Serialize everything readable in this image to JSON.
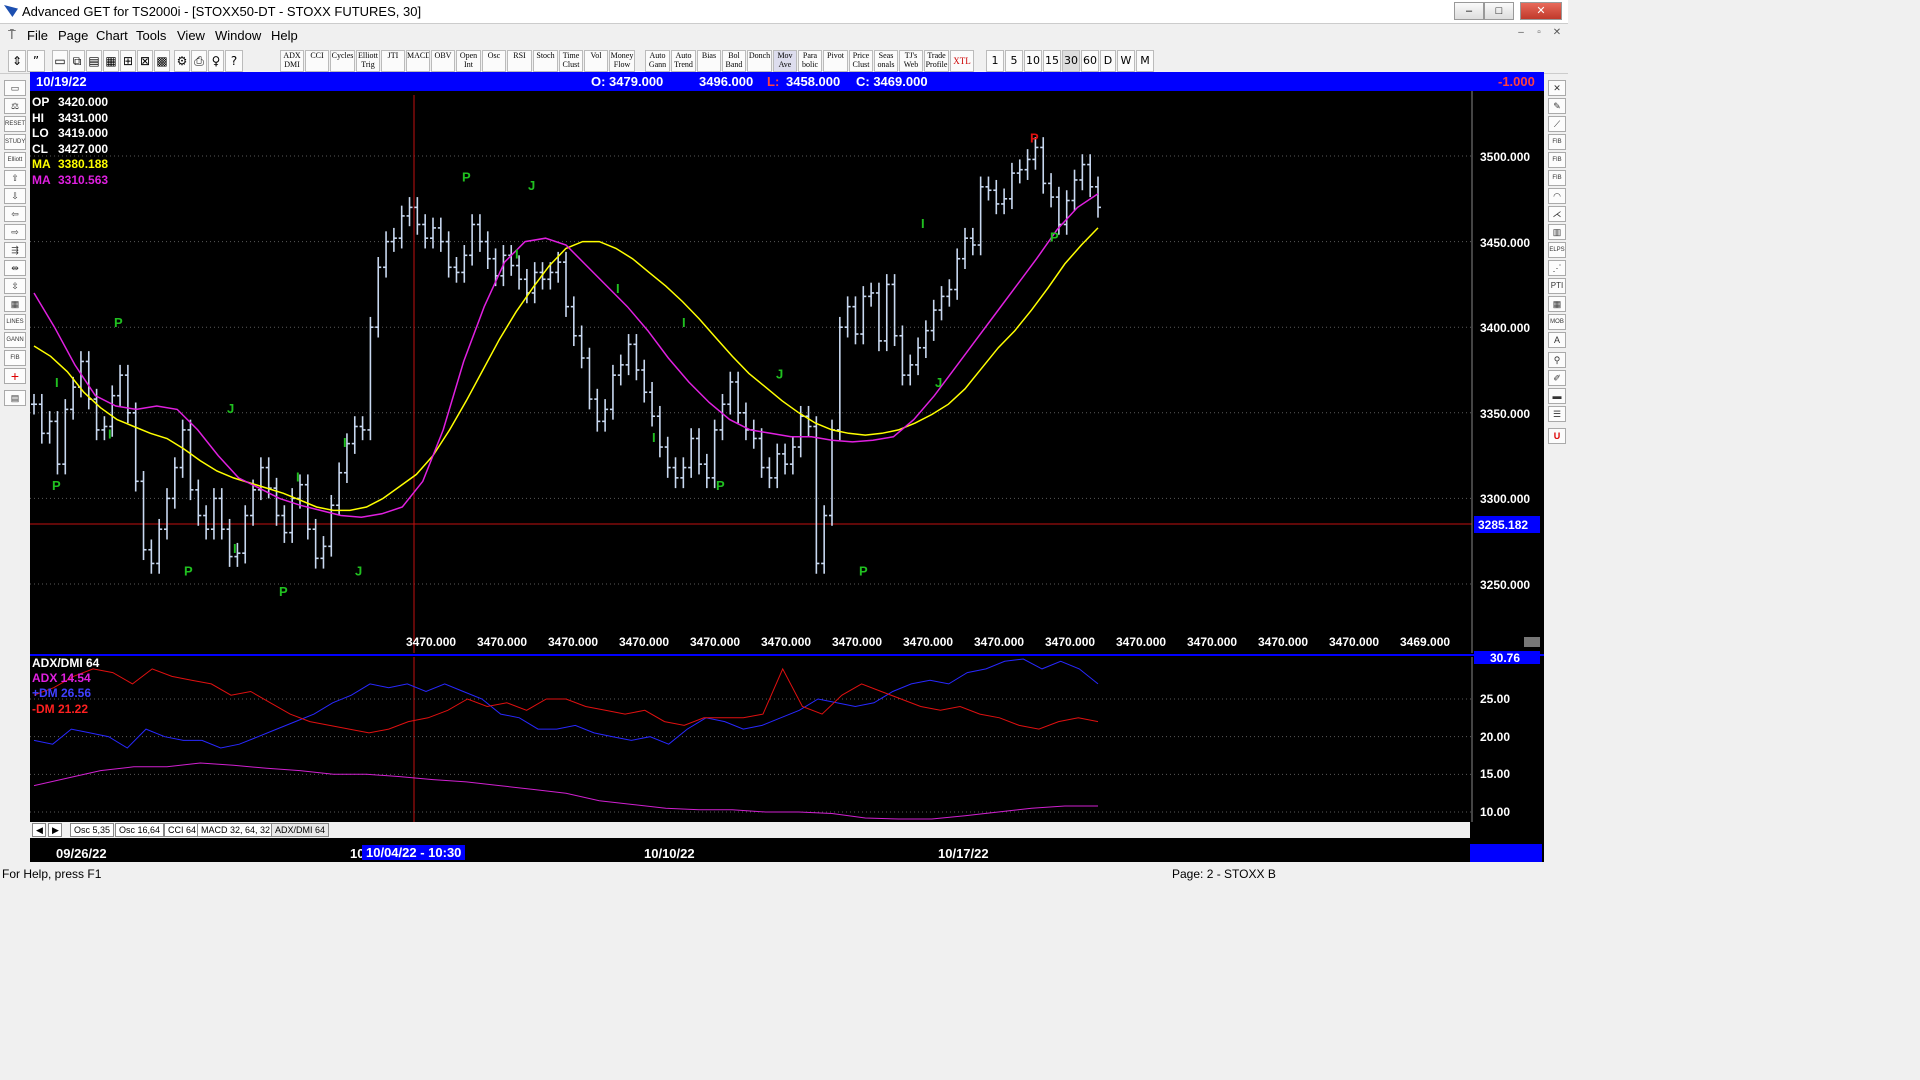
{
  "window": {
    "title": "Advanced GET for TS2000i - [STOXX50-DT - STOXX FUTURES, 30]",
    "min": "–",
    "max": "□",
    "close": "✕"
  },
  "menu": [
    "File",
    "Page",
    "Chart",
    "Tools",
    "View",
    "Window",
    "Help"
  ],
  "toolbar_studies": [
    "ADX DMI",
    "CCI",
    "Cycles",
    "Elliott Trig",
    "JTI",
    "MACD",
    "OBV",
    "Open Int",
    "Osc",
    "RSI",
    "Stoch",
    "Time Clust",
    "Vol",
    "Money Flow",
    "Auto Gann",
    "Auto Trend",
    "Bias",
    "Bol Band",
    "Donch",
    "Mov Ave",
    "Para bolic",
    "Pivot",
    "Price Clust",
    "Seas onals",
    "TJ's Web",
    "Trade Profile",
    "XTL"
  ],
  "toolbar_intervals": [
    "1",
    "5",
    "10",
    "15",
    "30",
    "60",
    "D",
    "W",
    "M"
  ],
  "header": {
    "date": "10/19/22",
    "open": "O: 3479.000",
    "high": "3496.000",
    "low_label": "L:",
    "low": "3458.000",
    "close": "C: 3469.000",
    "change": "-1.000"
  },
  "info": {
    "op_label": "OP",
    "op": "3420.000",
    "hi_label": "HI",
    "hi": "3431.000",
    "lo_label": "LO",
    "lo": "3419.000",
    "cl_label": "CL",
    "cl": "3427.000",
    "ma1_label": "MA",
    "ma1": "3380.188",
    "ma2_label": "MA",
    "ma2": "3310.563"
  },
  "price_axis": [
    "3500.000",
    "3450.000",
    "3400.000",
    "3350.000",
    "3300.000",
    "3250.000"
  ],
  "cursor_price": "3285.182",
  "bottom_values": [
    "3470.000",
    "3470.000",
    "3470.000",
    "3470.000",
    "3470.000",
    "3470.000",
    "3470.000",
    "3470.000",
    "3470.000",
    "3470.000",
    "3470.000",
    "3470.000",
    "3470.000",
    "3470.000",
    "3469.000"
  ],
  "wave_labels": [
    "I",
    "P",
    "I",
    "P",
    "P",
    "I",
    "J",
    "I",
    "P",
    "J",
    "I",
    "P",
    "I",
    "J",
    "I",
    "P",
    "J",
    "I",
    "P",
    "P",
    "I",
    "J",
    "P",
    "I"
  ],
  "indicator": {
    "name": "ADX/DMI 64",
    "adx": "ADX 14.54",
    "plus_dm": "+DM 26.56",
    "minus_dm": "-DM  21.22",
    "top_value": "30.76",
    "axis": [
      "25.00",
      "20.00",
      "15.00",
      "10.00"
    ]
  },
  "tabs": [
    "Osc 5,35",
    "Osc 16,64",
    "CCI 64",
    "MACD 32, 64, 32",
    "ADX/DMI 64"
  ],
  "dates": {
    "d1": "09/26/22",
    "d2_prefix": "10",
    "cursor_date": "10/04/22 - 10:30",
    "d3": "10/10/22",
    "d4": "10/17/22"
  },
  "status": {
    "help": "For Help, press F1",
    "page": "Page: 2 - STOXX B"
  },
  "chart_data": {
    "type": "line",
    "title": "",
    "ylim": [
      3220,
      3530
    ],
    "series": [
      {
        "values": [
          3355,
          3338,
          3345,
          3320,
          3352,
          3365,
          3380,
          3358,
          3340,
          3342,
          3360,
          3372,
          3350,
          3310,
          3270,
          3262,
          3282,
          3300,
          3318,
          3340,
          3305,
          3290,
          3282,
          3300,
          3282,
          3266,
          3268,
          3290,
          3305,
          3318,
          3306,
          3290,
          3280,
          3300,
          3308,
          3282,
          3265,
          3272,
          3296,
          3315,
          3332,
          3342,
          3340,
          3400,
          3435,
          3450,
          3452,
          3465,
          3470,
          3460,
          3452,
          3458,
          3450,
          3435,
          3432,
          3442,
          3460,
          3450,
          3440,
          3430,
          3442,
          3436,
          3428,
          3420,
          3432,
          3428,
          3432,
          3438,
          3412,
          3395,
          3382,
          3358,
          3345,
          3352,
          3372,
          3378,
          3390,
          3375,
          3362,
          3348,
          3330,
          3318,
          3312,
          3318,
          3335,
          3320,
          3312,
          3340,
          3355,
          3368,
          3350,
          3340,
          3335,
          3318,
          3312,
          3326,
          3320,
          3330,
          3348,
          3342,
          3262,
          3290,
          3340,
          3400,
          3412,
          3396,
          3418,
          3420,
          3392,
          3425,
          3395,
          3372,
          3378,
          3388,
          3398,
          3410,
          3418,
          3422,
          3440,
          3452,
          3448,
          3482,
          3480,
          3472,
          3475,
          3490,
          3492,
          3498,
          3505,
          3484,
          3476,
          3460,
          3474,
          3486,
          3495,
          3482,
          3470
        ]
      },
      {
        "name": "MA",
        "values": [
          3389,
          3383,
          3374,
          3362,
          3353,
          3346,
          3342,
          3338,
          3335,
          3329,
          3322,
          3316,
          3312,
          3309,
          3306,
          3303,
          3299,
          3295,
          3293,
          3293,
          3295,
          3300,
          3307,
          3314,
          3325,
          3340,
          3357,
          3375,
          3393,
          3409,
          3423,
          3436,
          3446,
          3450,
          3450,
          3446,
          3440,
          3432,
          3424,
          3415,
          3405,
          3394,
          3383,
          3373,
          3365,
          3357,
          3350,
          3344,
          3340,
          3338,
          3337,
          3338,
          3340,
          3344,
          3349,
          3355,
          3364,
          3376,
          3388,
          3398,
          3410,
          3423,
          3437,
          3448,
          3458
        ]
      },
      {
        "name": "MA",
        "values": [
          3420,
          3400,
          3378,
          3360,
          3354,
          3352,
          3354,
          3352,
          3340,
          3325,
          3312,
          3306,
          3300,
          3296,
          3293,
          3290,
          3289,
          3291,
          3295,
          3310,
          3340,
          3380,
          3412,
          3438,
          3450,
          3452,
          3448,
          3436,
          3424,
          3412,
          3398,
          3382,
          3368,
          3356,
          3346,
          3340,
          3338,
          3336,
          3336,
          3334,
          3333,
          3334,
          3336,
          3346,
          3360,
          3376,
          3392,
          3408,
          3424,
          3440,
          3457,
          3470,
          3478
        ]
      }
    ],
    "indicator_series": [
      {
        "name": "+DM",
        "values": [
          19.5,
          19,
          21,
          20.5,
          20,
          18.5,
          21,
          20,
          19.5,
          19.5,
          18.5,
          19,
          20,
          21,
          22,
          23,
          24.5,
          25.5,
          27,
          26.5,
          27,
          26,
          27,
          26,
          25,
          23,
          22.5,
          21,
          21,
          21.5,
          20.5,
          20,
          19.5,
          20,
          19,
          21,
          22.5,
          22,
          21,
          21.5,
          22.5,
          23.5,
          25,
          24.5,
          24,
          24.5,
          26,
          27,
          27.5,
          27,
          28.5,
          29,
          30,
          30.5,
          29,
          30,
          29,
          27
        ]
      },
      {
        "name": "-DM",
        "values": [
          25.5,
          26.5,
          28,
          29,
          28.5,
          27,
          29,
          28,
          27.5,
          27,
          25.5,
          26,
          24.5,
          23,
          22,
          21.5,
          21,
          20.5,
          21,
          22,
          22.5,
          23.5,
          25,
          24,
          24.5,
          23.5,
          25,
          25,
          24,
          23.5,
          23,
          23.5,
          22,
          21.5,
          22.5,
          22.5,
          22.5,
          23,
          29,
          24,
          23,
          25.5,
          27,
          26,
          25,
          24,
          23.5,
          24,
          23,
          22.5,
          21.5,
          21,
          22,
          22.5,
          22
        ]
      },
      {
        "name": "ADX",
        "values": [
          13.5,
          14.5,
          15.5,
          16,
          16,
          16.5,
          16.2,
          15.8,
          15.5,
          15,
          15,
          14.7,
          14.3,
          14,
          13.5,
          13,
          12.5,
          11.5,
          11,
          10.5,
          10.3,
          10.3,
          10,
          10,
          9.8,
          9.2,
          9,
          9,
          9.5,
          10,
          10.5,
          10.8,
          10.8
        ]
      }
    ]
  }
}
